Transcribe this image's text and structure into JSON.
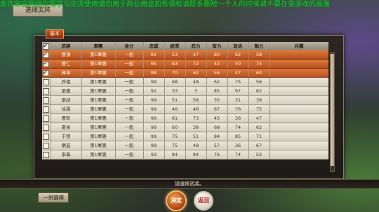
{
  "banner": "本作来自网络仅限学习交流使用请勿用于商业用途如有侵权请联系删除一个人的时候请不要在意游戏的画面",
  "title": "選擇武將",
  "tab": "基本",
  "columns": [
    "",
    "武將",
    "軍團",
    "身分",
    "忠誠",
    "統率",
    "武力",
    "智力",
    "政治",
    "魅力",
    "兵糧"
  ],
  "rows": [
    {
      "checked": true,
      "selected": true,
      "cells": [
        "曹操",
        "第1軍團",
        "一般",
        "81",
        "53",
        "47",
        "60",
        "62",
        "58",
        "",
        ""
      ]
    },
    {
      "checked": true,
      "selected": true,
      "cells": [
        "曹仁",
        "第1軍團",
        "一般",
        "95",
        "63",
        "72",
        "42",
        "40",
        "74",
        ""
      ]
    },
    {
      "checked": true,
      "selected": true,
      "cells": [
        "典韋",
        "第1軍團",
        "一般",
        "88",
        "70",
        "62",
        "56",
        "47",
        "60",
        ""
      ]
    },
    {
      "checked": false,
      "selected": false,
      "cells": [
        "許褚",
        "第1軍團",
        "一般",
        "99",
        "68",
        "48",
        "62",
        "75",
        "56",
        ""
      ]
    },
    {
      "checked": false,
      "selected": false,
      "cells": [
        "張遼",
        "第1軍團",
        "一般",
        "91",
        "33",
        "3",
        "85",
        "97",
        "82",
        ""
      ]
    },
    {
      "checked": false,
      "selected": false,
      "cells": [
        "張郃",
        "第1軍團",
        "一般",
        "99",
        "51",
        "58",
        "35",
        "31",
        "36",
        ""
      ]
    },
    {
      "checked": false,
      "selected": false,
      "cells": [
        "徐晃",
        "第1軍團",
        "一般",
        "99",
        "46",
        "46",
        "67",
        "76",
        "75",
        ""
      ]
    },
    {
      "checked": false,
      "selected": false,
      "cells": [
        "曹彰",
        "第1軍團",
        "一般",
        "99",
        "61",
        "73",
        "45",
        "36",
        "47",
        ""
      ]
    },
    {
      "checked": false,
      "selected": false,
      "cells": [
        "夏侯",
        "第1軍團",
        "一般",
        "99",
        "60",
        "38",
        "68",
        "74",
        "62",
        ""
      ]
    },
    {
      "checked": false,
      "selected": false,
      "cells": [
        "于禁",
        "第1軍團",
        "一般",
        "99",
        "75",
        "51",
        "84",
        "85",
        "71",
        ""
      ]
    },
    {
      "checked": false,
      "selected": false,
      "cells": [
        "樂進",
        "第1軍團",
        "一般",
        "99",
        "75",
        "48",
        "57",
        "36",
        "67",
        ""
      ]
    },
    {
      "checked": false,
      "selected": false,
      "cells": [
        "李典",
        "第1軍團",
        "一般",
        "93",
        "84",
        "84",
        "76",
        "74",
        "52",
        ""
      ]
    }
  ],
  "status": "請選擇武將。",
  "buttons": {
    "all": "一併選擇",
    "confirm": "決定",
    "back": "返回"
  }
}
